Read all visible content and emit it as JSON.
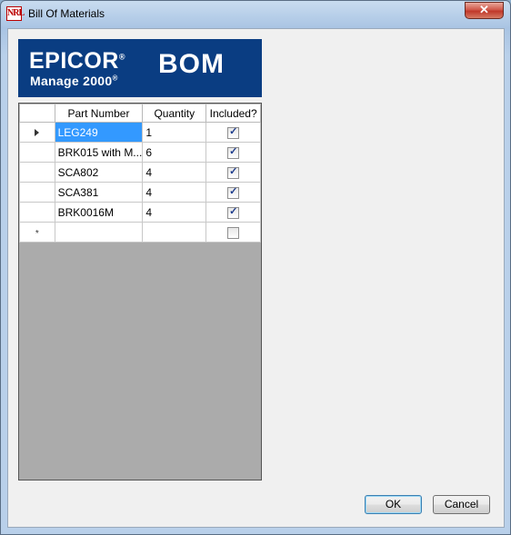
{
  "window": {
    "title": "Bill Of Materials",
    "app_icon_text": "NRL",
    "close_glyph": "✕"
  },
  "banner": {
    "brand": "EPICOR",
    "product": "Manage 2000",
    "product_mark": "®",
    "brand_mark": "®",
    "module": "BOM"
  },
  "grid": {
    "columns": [
      "Part Number",
      "Quantity",
      "Included?"
    ],
    "rows": [
      {
        "part": "LEG249",
        "qty": "1",
        "included": true
      },
      {
        "part": "BRK015 with M...",
        "qty": "6",
        "included": true
      },
      {
        "part": "SCA802",
        "qty": "4",
        "included": true
      },
      {
        "part": "SCA381",
        "qty": "4",
        "included": true
      },
      {
        "part": "BRK0016M",
        "qty": "4",
        "included": true
      }
    ],
    "new_row": {
      "marker": "*",
      "part": "",
      "qty": "",
      "included": false
    },
    "current_row_marker": "arrow-right-icon"
  },
  "buttons": {
    "ok": "OK",
    "cancel": "Cancel"
  }
}
